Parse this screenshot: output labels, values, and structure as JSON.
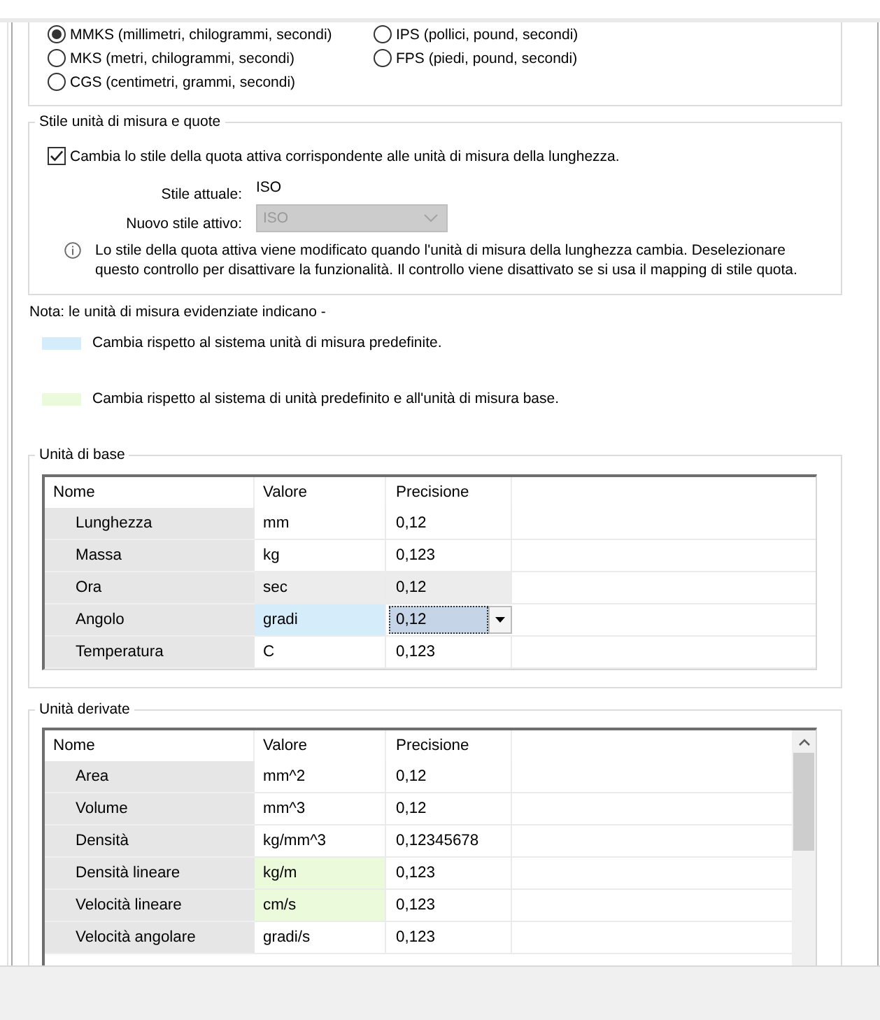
{
  "unit_systems": {
    "options": [
      {
        "label": "MMKS (millimetri, chilogrammi, secondi)",
        "selected": true
      },
      {
        "label": "IPS (pollici, pound, secondi)",
        "selected": false
      },
      {
        "label": "MKS (metri, chilogrammi, secondi)",
        "selected": false
      },
      {
        "label": "FPS (piedi, pound, secondi)",
        "selected": false
      },
      {
        "label": "CGS (centimetri, grammi, secondi)",
        "selected": false
      }
    ]
  },
  "dimension_style": {
    "title": "Stile unità di misura e quote",
    "checkbox": {
      "label": "Cambia lo stile della quota attiva corrispondente alle unità di misura della lunghezza.",
      "checked": true
    },
    "current_style": {
      "label": "Stile attuale:",
      "value": "ISO"
    },
    "new_style": {
      "label": "Nuovo stile attivo:",
      "value": "ISO",
      "disabled": true
    },
    "info": "Lo stile della quota attiva viene modificato quando l'unità di misura della lunghezza cambia. Deselezionare questo controllo per disattivare la funzionalità. Il controllo viene disattivato se si usa il mapping di stile quota."
  },
  "note": {
    "text": "Nota: le unità di misura evidenziate indicano -",
    "legend": [
      {
        "color": "#d5ecfb",
        "label": "Cambia rispetto al sistema unità di misura predefinite."
      },
      {
        "color": "#ebfada",
        "label": "Cambia rispetto al sistema di unità predefinito e all'unità di misura base."
      }
    ]
  },
  "base_units": {
    "title": "Unità di base",
    "columns": [
      "Nome",
      "Valore",
      "Precisione"
    ],
    "rows": [
      {
        "name": "Lunghezza",
        "value": "mm",
        "precision": "0,12",
        "hovered": false,
        "editing": false
      },
      {
        "name": "Massa",
        "value": "kg",
        "precision": "0,123",
        "hovered": false,
        "editing": false
      },
      {
        "name": "Ora",
        "value": "sec",
        "precision": "0,12",
        "hovered": true,
        "editing": false
      },
      {
        "name": "Angolo",
        "value": "gradi",
        "precision": "0,12",
        "color": "#d5ecfb",
        "hovered": false,
        "editing": true
      },
      {
        "name": "Temperatura",
        "value": "C",
        "precision": "0,123",
        "hovered": false,
        "editing": false
      }
    ]
  },
  "derived_units": {
    "title": "Unità derivate",
    "columns": [
      "Nome",
      "Valore",
      "Precisione"
    ],
    "rows": [
      {
        "name": "Area",
        "value": "mm^2",
        "precision": "0,12",
        "hovered": false,
        "editing": false
      },
      {
        "name": "Volume",
        "value": "mm^3",
        "precision": "0,12",
        "hovered": false,
        "editing": false
      },
      {
        "name": "Densità",
        "value": "kg/mm^3",
        "precision": "0,12345678",
        "hovered": false,
        "editing": false
      },
      {
        "name": "Densità lineare",
        "value": "kg/m",
        "precision": "0,123",
        "color": "#ebfada",
        "hovered": false,
        "editing": false
      },
      {
        "name": "Velocità lineare",
        "value": "cm/s",
        "precision": "0,123",
        "color": "#ebfada",
        "hovered": false,
        "editing": false
      },
      {
        "name": "Velocità angolare",
        "value": "gradi/s",
        "precision": "0,123",
        "hovered": false,
        "editing": false
      }
    ]
  }
}
